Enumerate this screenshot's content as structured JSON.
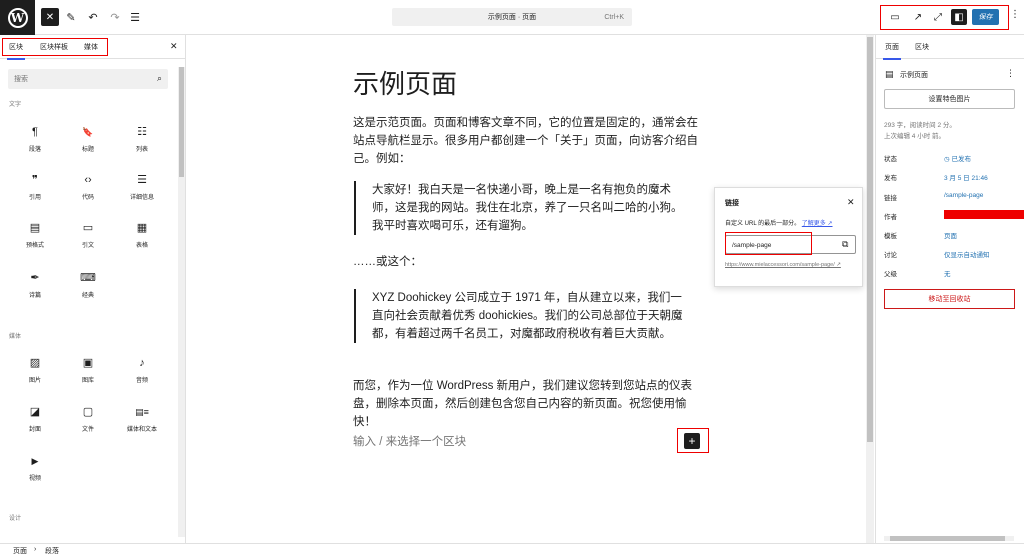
{
  "topbar": {
    "logo": "W",
    "close_icon": "✕",
    "pen_icon": "✎",
    "undo_icon": "↶",
    "redo_icon": "↷",
    "list_icon": "☰",
    "command_title": "示例页面 · 页面",
    "command_shortcut": "Ctrl+K",
    "view_icon": "▭",
    "external_icon": "↗",
    "expand_icon": "⤢",
    "sidebar_icon": "◧",
    "save_label": "保存",
    "more_icon": "⋮"
  },
  "inserter": {
    "tabs": [
      "区块",
      "区块样板",
      "媒体"
    ],
    "close_icon": "✕",
    "search_placeholder": "搜索",
    "search_icon": "⌕",
    "categories": {
      "text": "文字",
      "media": "媒体",
      "design": "设计"
    },
    "text_blocks": [
      {
        "icon": "¶",
        "label": "段落"
      },
      {
        "icon": "🔖",
        "label": "标题"
      },
      {
        "icon": "☷",
        "label": "列表"
      },
      {
        "icon": "❞",
        "label": "引用"
      },
      {
        "icon": "‹›",
        "label": "代码"
      },
      {
        "icon": "☰",
        "label": "详细信息"
      },
      {
        "icon": "▤",
        "label": "预格式"
      },
      {
        "icon": "▭",
        "label": "引文"
      },
      {
        "icon": "▦",
        "label": "表格"
      },
      {
        "icon": "✒",
        "label": "诗篇"
      },
      {
        "icon": "⌨",
        "label": "经典"
      }
    ],
    "media_blocks": [
      {
        "icon": "▨",
        "label": "图片"
      },
      {
        "icon": "▣",
        "label": "图库"
      },
      {
        "icon": "♪",
        "label": "音频"
      },
      {
        "icon": "◪",
        "label": "封面"
      },
      {
        "icon": "▢",
        "label": "文件"
      },
      {
        "icon": "▤≡",
        "label": "媒体和文本"
      },
      {
        "icon": "▶",
        "label": "视频"
      }
    ]
  },
  "editor": {
    "title": "示例页面",
    "paragraph1": "这是示范页面。页面和博客文章不同，它的位置是固定的，通常会在站点导航栏显示。很多用户都创建一个「关于」页面，向访客介绍自己。例如：",
    "quote1": "大家好！我白天是一名快递小哥，晚上是一名有抱负的魔术师，这是我的网站。我住在北京，养了一只名叫二哈的小狗。我平时喜欢喝可乐，还有遛狗。",
    "paragraph2": "……或这个：",
    "quote2": "XYZ Doohickey 公司成立于 1971 年，自从建立以来，我们一直向社会贡献着优秀 doohickies。我们的公司总部位于天朝魔都，有着超过两千名员工，对魔都政府税收有着巨大贡献。",
    "paragraph3": "而您，作为一位 WordPress 新用户，我们建议您转到您站点的仪表盘，删除本页面，然后创建包含您自己内容的新页面。祝您使用愉快！",
    "placeholder": "输入 / 来选择一个区块",
    "plus_icon": "+"
  },
  "link_popover": {
    "title": "链接",
    "close_icon": "✕",
    "description": "自定义 URL 的最后一部分。",
    "learn_more": "了解更多 ↗",
    "slug_value": "/sample-page",
    "copy_icon": "⧉",
    "full_url": "https://www.mielaccessori.com/sample-page/ ↗"
  },
  "settings": {
    "tabs": [
      "页面",
      "区块"
    ],
    "doc_icon": "▤",
    "doc_title": "示例页面",
    "doc_more": "⋮",
    "featured_image": "设置特色图片",
    "meta_words": "293 字，阅读时间 2 分。",
    "meta_edited": "上次编辑 4 小时 前。",
    "rows": [
      {
        "key": "状态",
        "value": "◷ 已发布"
      },
      {
        "key": "发布",
        "value": "3 月 5 日 21:46"
      },
      {
        "key": "链接",
        "value": "/sample-page"
      },
      {
        "key": "作者",
        "value": ""
      },
      {
        "key": "模板",
        "value": "页面"
      },
      {
        "key": "讨论",
        "value": "仅显示自动通知"
      },
      {
        "key": "父级",
        "value": "无"
      }
    ],
    "trash": "移动至回收站"
  },
  "breadcrumb": {
    "items": [
      "页面",
      "段落"
    ],
    "separator": "›"
  }
}
